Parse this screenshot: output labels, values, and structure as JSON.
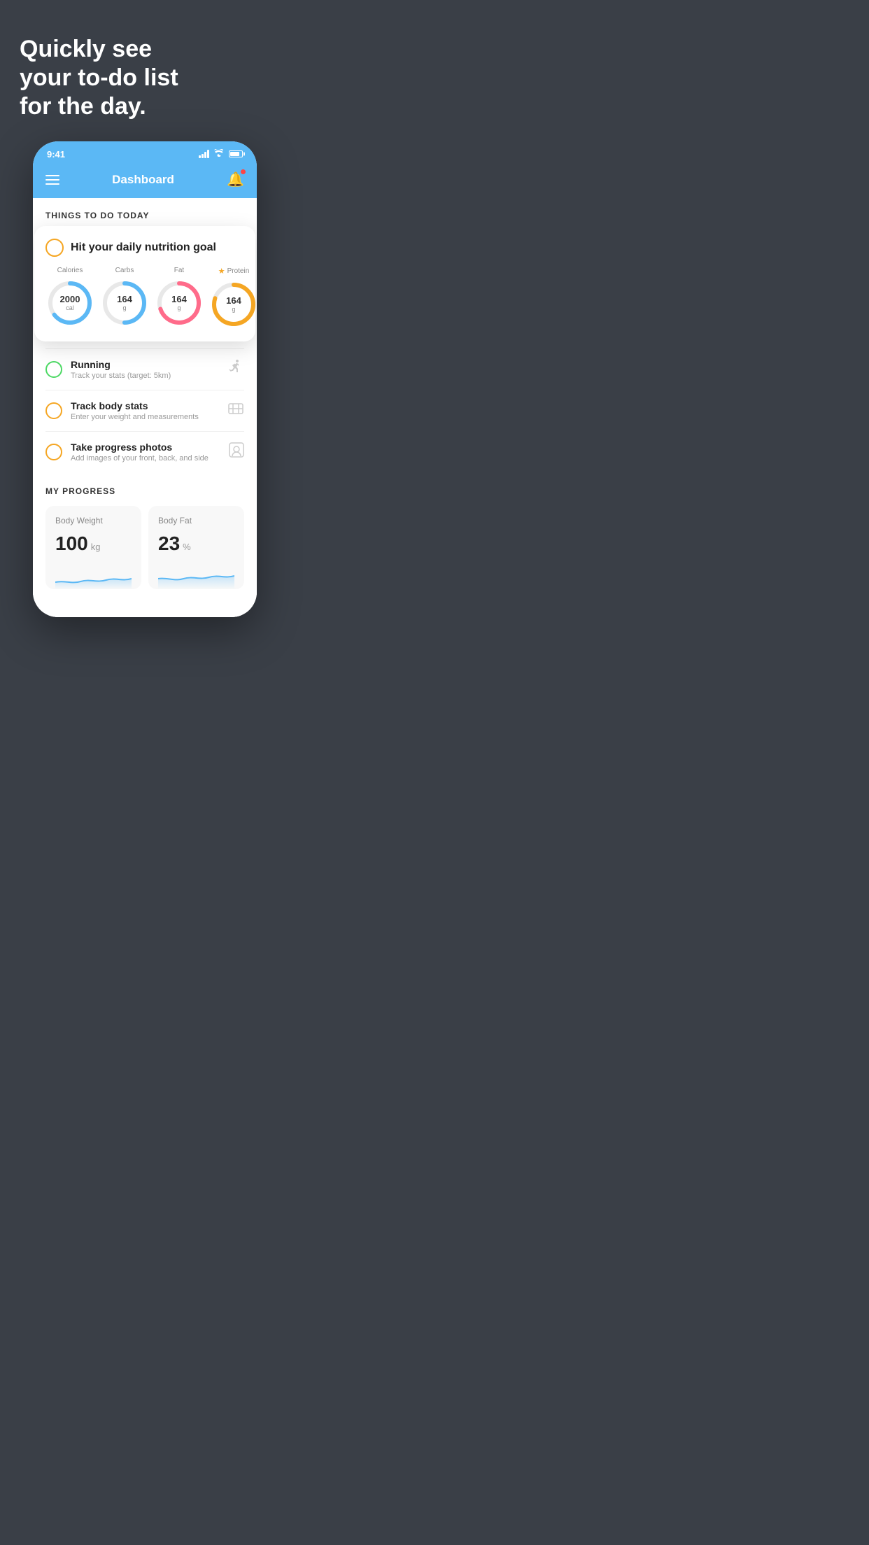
{
  "background_color": "#3a3f47",
  "headline": {
    "line1": "Quickly see",
    "line2": "your to-do list",
    "line3": "for the day."
  },
  "status_bar": {
    "time": "9:41",
    "bg_color": "#5bb8f5"
  },
  "header": {
    "title": "Dashboard",
    "bg_color": "#5bb8f5"
  },
  "things_section": {
    "title": "THINGS TO DO TODAY"
  },
  "nutrition_card": {
    "title": "Hit your daily nutrition goal",
    "circle_color": "#f5a623",
    "items": [
      {
        "label": "Calories",
        "value": "2000",
        "unit": "cal",
        "color": "#5bb8f5",
        "percent": 65
      },
      {
        "label": "Carbs",
        "value": "164",
        "unit": "g",
        "color": "#5bb8f5",
        "percent": 50
      },
      {
        "label": "Fat",
        "value": "164",
        "unit": "g",
        "color": "#ff6b8a",
        "percent": 70
      },
      {
        "label": "Protein",
        "value": "164",
        "unit": "g",
        "color": "#f5a623",
        "percent": 80,
        "starred": true
      }
    ]
  },
  "todo_items": [
    {
      "name": "Running",
      "desc": "Track your stats (target: 5km)",
      "circle_color": "green",
      "icon": "👟"
    },
    {
      "name": "Track body stats",
      "desc": "Enter your weight and measurements",
      "circle_color": "yellow",
      "icon": "⚖️"
    },
    {
      "name": "Take progress photos",
      "desc": "Add images of your front, back, and side",
      "circle_color": "yellow",
      "icon": "👤"
    }
  ],
  "progress_section": {
    "title": "MY PROGRESS",
    "cards": [
      {
        "title": "Body Weight",
        "value": "100",
        "unit": "kg"
      },
      {
        "title": "Body Fat",
        "value": "23",
        "unit": "%"
      }
    ]
  }
}
